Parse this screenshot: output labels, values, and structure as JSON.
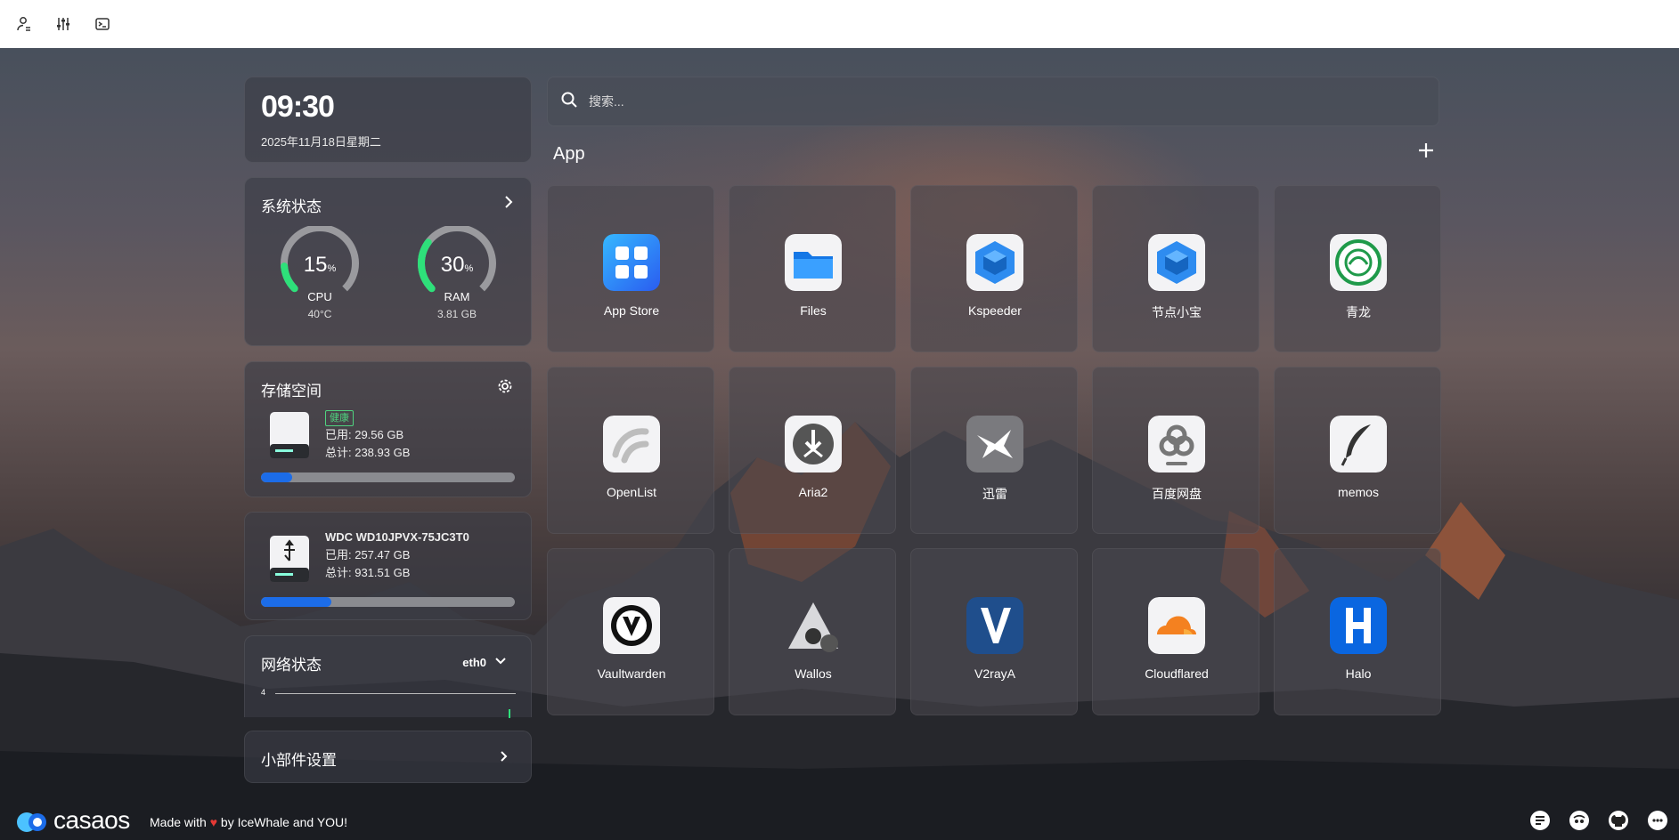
{
  "clock": {
    "time": "09:30",
    "date": "2025年11月18日星期二"
  },
  "system": {
    "title": "系统状态",
    "cpu": {
      "value": "15",
      "unit": "%",
      "label": "CPU",
      "sub": "40°C",
      "percent": 15
    },
    "ram": {
      "value": "30",
      "unit": "%",
      "label": "RAM",
      "sub": "3.81 GB",
      "percent": 30
    }
  },
  "storage": {
    "title": "存储空间",
    "disk1": {
      "badge": "健康",
      "used": "已用: 29.56 GB",
      "total": "总计: 238.93 GB",
      "fraction": 0.124
    },
    "disk2": {
      "name": "WDC WD10JPVX-75JC3T0",
      "used": "已用: 257.47 GB",
      "total": "总计: 931.51 GB",
      "fraction": 0.276
    }
  },
  "network": {
    "title": "网络状态",
    "iface": "eth0",
    "scale_label": "4"
  },
  "widgets": {
    "title": "小部件设置"
  },
  "search": {
    "placeholder": "搜索..."
  },
  "apps": {
    "title": "App",
    "items": [
      {
        "name": "App Store"
      },
      {
        "name": "Files"
      },
      {
        "name": "Kspeeder"
      },
      {
        "name": "节点小宝"
      },
      {
        "name": "青龙"
      },
      {
        "name": "OpenList"
      },
      {
        "name": "Aria2"
      },
      {
        "name": "迅雷"
      },
      {
        "name": "百度网盘"
      },
      {
        "name": "memos"
      },
      {
        "name": "Vaultwarden"
      },
      {
        "name": "Wallos"
      },
      {
        "name": "V2rayA"
      },
      {
        "name": "Cloudflared"
      },
      {
        "name": "Halo"
      }
    ]
  },
  "footer": {
    "brand": "casaos",
    "made_with": "Made with",
    "by": "by IceWhale and YOU!"
  },
  "colors": {
    "accent": "#1c6ce8",
    "health": "#4fd37f",
    "gauge_green": "#2ee07a",
    "gauge_track": "#9a9a9e",
    "heart": "#e53935"
  }
}
